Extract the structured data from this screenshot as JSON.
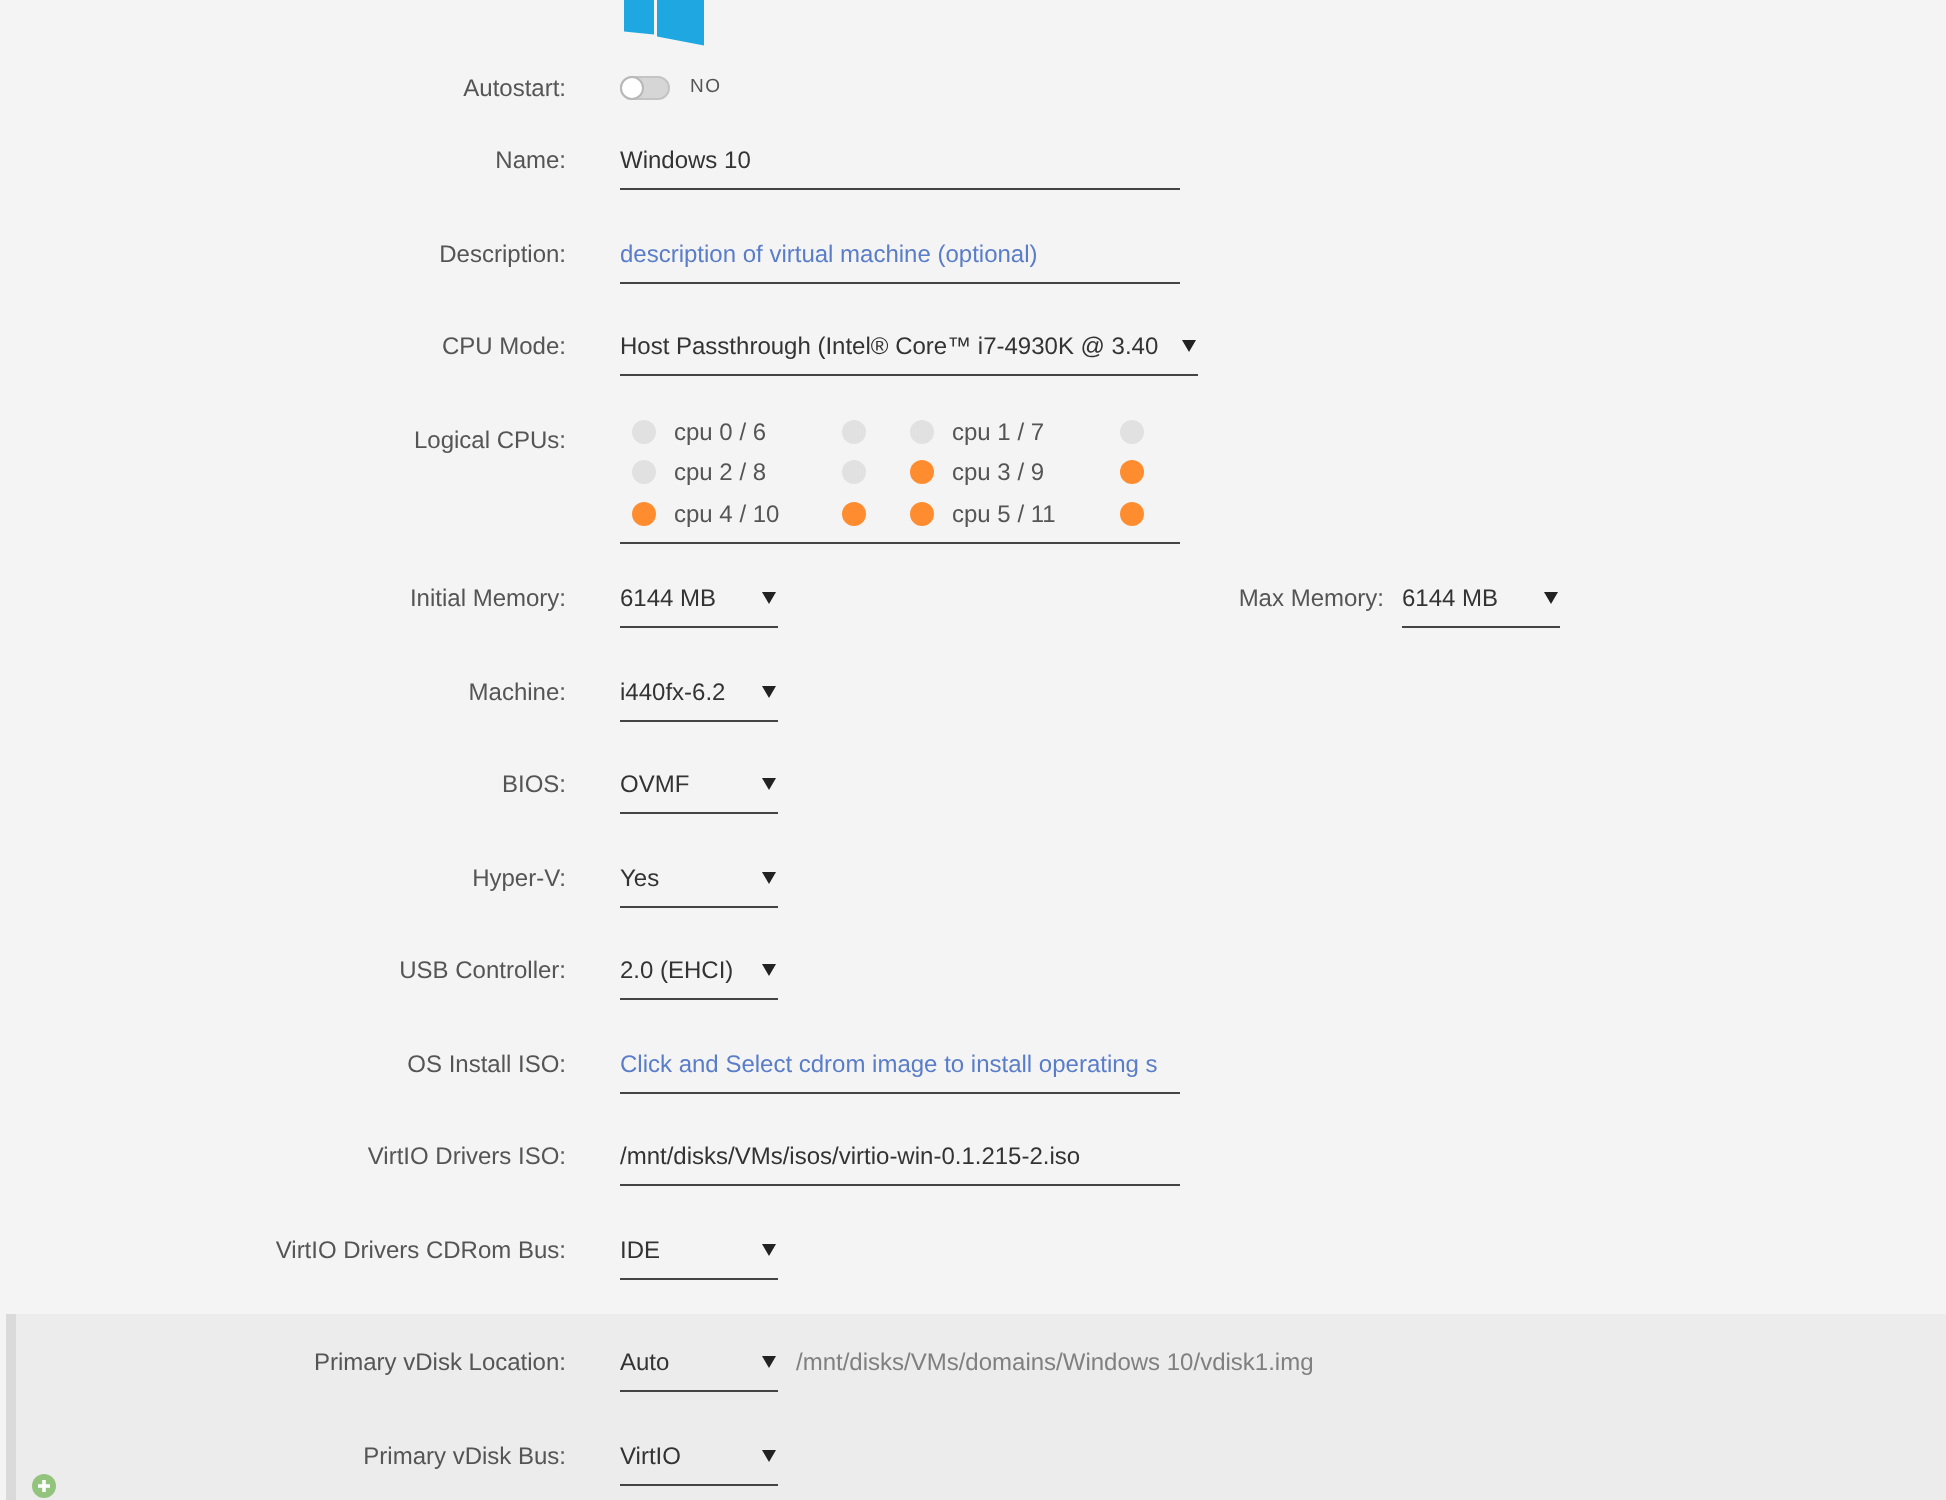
{
  "rows": [
    {
      "kind": "toggle",
      "label": "Autostart:",
      "on": false,
      "state_text": "NO"
    },
    {
      "kind": "text",
      "label": "Name:",
      "value": "Windows 10"
    },
    {
      "kind": "text",
      "label": "Description:",
      "placeholder": "description of virtual machine (optional)"
    },
    {
      "kind": "select",
      "label": "CPU Mode:",
      "value": "Host Passthrough (Intel® Core™ i7-4930K @ 3.40"
    },
    {
      "kind": "cpus",
      "label": "Logical CPUs:",
      "cpus": [
        {
          "label": "cpu 0 / 6",
          "threads": [
            {
              "checked": false
            },
            {
              "checked": false
            }
          ]
        },
        {
          "label": "cpu 1 / 7",
          "threads": [
            {
              "checked": false
            },
            {
              "checked": false
            }
          ]
        },
        {
          "label": "cpu 2 / 8",
          "threads": [
            {
              "checked": false
            },
            {
              "checked": false
            }
          ]
        },
        {
          "label": "cpu 3 / 9",
          "threads": [
            {
              "checked": true
            },
            {
              "checked": true
            }
          ]
        },
        {
          "label": "cpu 4 / 10",
          "threads": [
            {
              "checked": true
            },
            {
              "checked": true
            }
          ]
        },
        {
          "label": "cpu 5 / 11",
          "threads": [
            {
              "checked": true
            },
            {
              "checked": true
            }
          ]
        }
      ]
    },
    {
      "kind": "select_pair",
      "label": "Initial Memory:",
      "value": "6144 MB",
      "second": {
        "label": "Max Memory:",
        "value": "6144 MB"
      }
    },
    {
      "kind": "select",
      "label": "Machine:",
      "value": "i440fx-6.2"
    },
    {
      "kind": "select",
      "label": "BIOS:",
      "value": "OVMF"
    },
    {
      "kind": "select",
      "label": "Hyper-V:",
      "value": "Yes"
    },
    {
      "kind": "select",
      "label": "USB Controller:",
      "value": "2.0 (EHCI)"
    },
    {
      "kind": "text",
      "label": "OS Install ISO:",
      "placeholder": "Click and Select cdrom image to install operating s"
    },
    {
      "kind": "text",
      "label": "VirtIO Drivers ISO:",
      "value": "/mnt/disks/VMs/isos/virtio-win-0.1.215-2.iso"
    },
    {
      "kind": "select",
      "label": "VirtIO Drivers CDRom Bus:",
      "value": "IDE"
    }
  ],
  "disk_section": {
    "rows": [
      {
        "kind": "select_path",
        "label": "Primary vDisk Location:",
        "value": "Auto",
        "path": {
          "value": "/mnt/disks/VMs/domains/Windows 10/vdisk1.img",
          "disabled": true
        }
      },
      {
        "kind": "select",
        "label": "Primary vDisk Bus:",
        "value": "VirtIO"
      }
    ]
  }
}
